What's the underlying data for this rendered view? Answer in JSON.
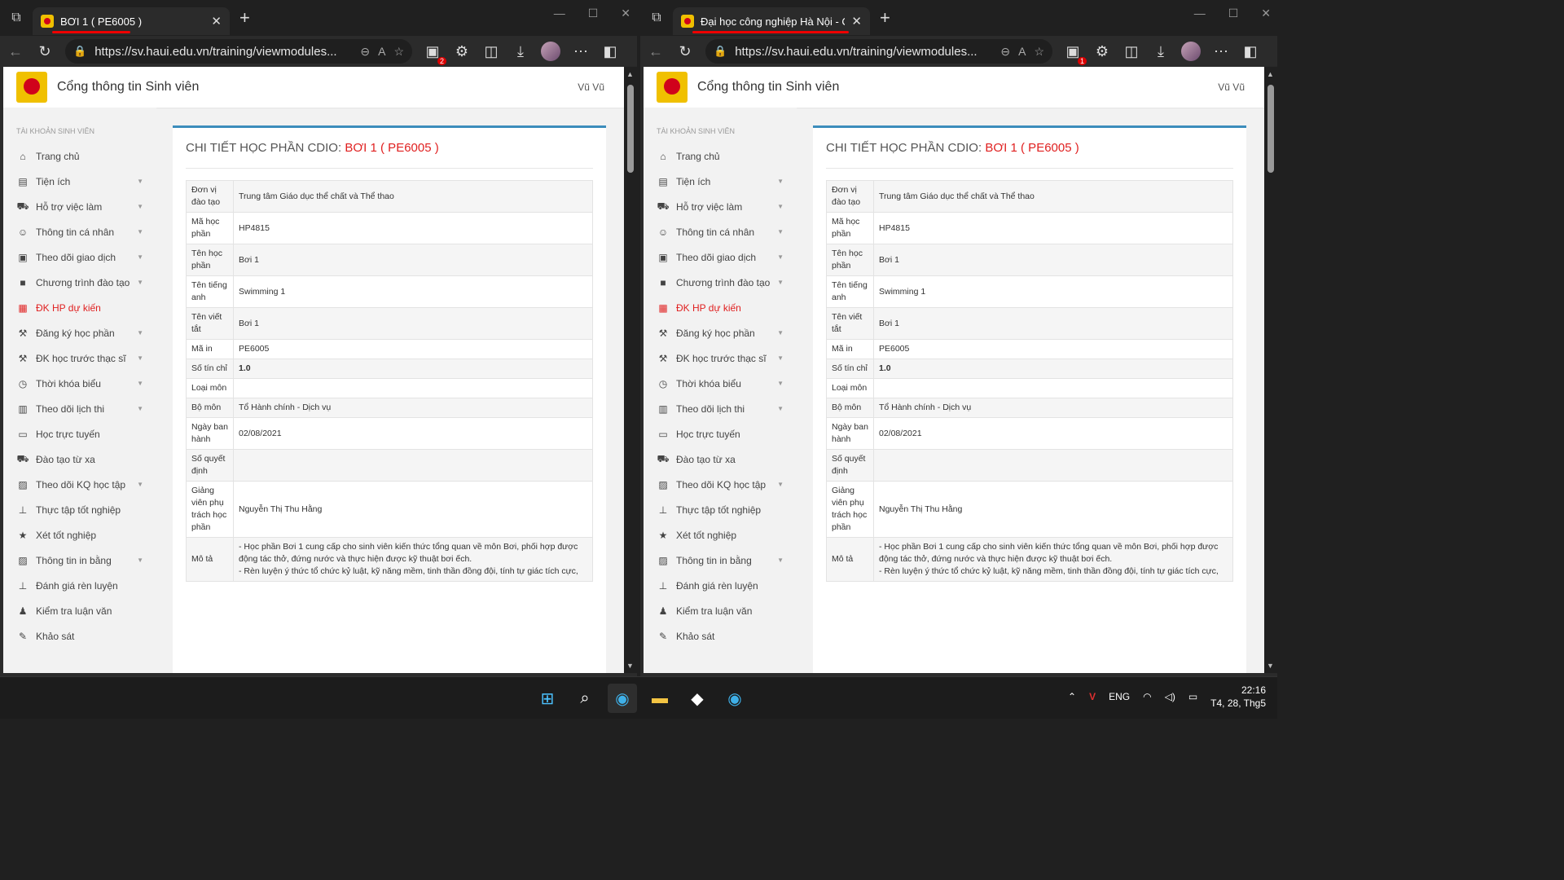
{
  "left": {
    "tab_title": "BƠI 1 ( PE6005 )",
    "ext_badge": "2"
  },
  "right": {
    "tab_title": "Đại học công nghiệp Hà Nội - Cổ",
    "ext_badge": "1"
  },
  "url": "https://sv.haui.edu.vn/training/viewmodules...",
  "site": {
    "title": "Cổng thông tin Sinh viên",
    "user": "Vũ Vũ"
  },
  "sidebar": {
    "heading": "TÀI KHOẢN SINH VIÊN",
    "items": [
      {
        "label": "Trang chủ",
        "icon": "home-icon",
        "glyph": "⌂",
        "caret": false,
        "active": false
      },
      {
        "label": "Tiện ích",
        "icon": "book-icon",
        "glyph": "▤",
        "caret": true,
        "active": false
      },
      {
        "label": "Hỗ trợ việc làm",
        "icon": "bus-icon",
        "glyph": "⛟",
        "caret": true,
        "active": false
      },
      {
        "label": "Thông tin cá nhân",
        "icon": "user-icon",
        "glyph": "☺",
        "caret": true,
        "active": false
      },
      {
        "label": "Theo dõi giao dịch",
        "icon": "ledger-icon",
        "glyph": "▣",
        "caret": true,
        "active": false
      },
      {
        "label": "Chương trình đào tạo",
        "icon": "bookmark-icon",
        "glyph": "■",
        "caret": true,
        "active": false
      },
      {
        "label": "ĐK HP dự kiến",
        "icon": "calendar-icon",
        "glyph": "▦",
        "caret": false,
        "active": true
      },
      {
        "label": "Đăng ký học phần",
        "icon": "gavel-icon",
        "glyph": "⚒",
        "caret": true,
        "active": false
      },
      {
        "label": "ĐK học trước thạc sĩ",
        "icon": "gavel-icon",
        "glyph": "⚒",
        "caret": true,
        "active": false
      },
      {
        "label": "Thời khóa biểu",
        "icon": "clock-icon",
        "glyph": "◷",
        "caret": true,
        "active": false
      },
      {
        "label": "Theo dõi lịch thi",
        "icon": "calendar-grid-icon",
        "glyph": "▥",
        "caret": true,
        "active": false
      },
      {
        "label": "Học trực tuyến",
        "icon": "laptop-icon",
        "glyph": "▭",
        "caret": false,
        "active": false
      },
      {
        "label": "Đào tạo từ xa",
        "icon": "bus-icon",
        "glyph": "⛟",
        "caret": false,
        "active": false
      },
      {
        "label": "Theo dõi KQ học tập",
        "icon": "report-icon",
        "glyph": "▨",
        "caret": true,
        "active": false
      },
      {
        "label": "Thực tập tốt nghiệp",
        "icon": "sitemap-icon",
        "glyph": "⊥",
        "caret": false,
        "active": false
      },
      {
        "label": "Xét tốt nghiệp",
        "icon": "star-icon",
        "glyph": "★",
        "caret": false,
        "active": false
      },
      {
        "label": "Thông tin in bằng",
        "icon": "report-icon",
        "glyph": "▨",
        "caret": true,
        "active": false
      },
      {
        "label": "Đánh giá rèn luyện",
        "icon": "sitemap-icon",
        "glyph": "⊥",
        "caret": false,
        "active": false
      },
      {
        "label": "Kiểm tra luận văn",
        "icon": "person-icon",
        "glyph": "♟",
        "caret": false,
        "active": false
      },
      {
        "label": "Khảo sát",
        "icon": "survey-icon",
        "glyph": "✎",
        "caret": false,
        "active": false
      }
    ]
  },
  "card": {
    "title_prefix": "CHI TIẾT HỌC PHẦN CDIO: ",
    "title_course": "BƠI 1 ( PE6005 )"
  },
  "details": [
    {
      "key": "Đơn vị đào tạo",
      "value": "Trung tâm Giáo dục thể chất và Thể thao"
    },
    {
      "key": "Mã học phần",
      "value": "HP4815"
    },
    {
      "key": "Tên học phần",
      "value": "Bơi 1"
    },
    {
      "key": "Tên tiếng anh",
      "value": "Swimming 1"
    },
    {
      "key": "Tên viết tắt",
      "value": "Bơi 1"
    },
    {
      "key": "Mã in",
      "value": "PE6005"
    },
    {
      "key": "Số tín chỉ",
      "value": "1.0",
      "bold": true
    },
    {
      "key": "Loại môn",
      "value": ""
    },
    {
      "key": "Bộ môn",
      "value": "Tổ Hành chính - Dịch vụ"
    },
    {
      "key": "Ngày ban hành",
      "value": "02/08/2021"
    },
    {
      "key": "Số quyết định",
      "value": ""
    },
    {
      "key": "Giảng viên phụ trách học phần",
      "value": "Nguyễn Thị Thu Hằng"
    },
    {
      "key": "Mô tả",
      "value": "- Học phần Bơi 1 cung cấp cho sinh viên kiến thức tổng quan về môn Bơi, phối hợp được động tác thở, đứng nước và thực hiện được kỹ thuật bơi ếch.\n- Rèn luyện ý thức tổ chức kỷ luật, kỹ năng mềm, tinh thần đồng đội, tính tự giác tích cực,"
    }
  ],
  "taskbar": {
    "lang": "ENG",
    "time": "22:16",
    "date": "T4, 28, Thg5"
  },
  "colors": {
    "accent_red": "#e02020",
    "card_top": "#3c8dbc",
    "tab_underline": "#e00000"
  }
}
